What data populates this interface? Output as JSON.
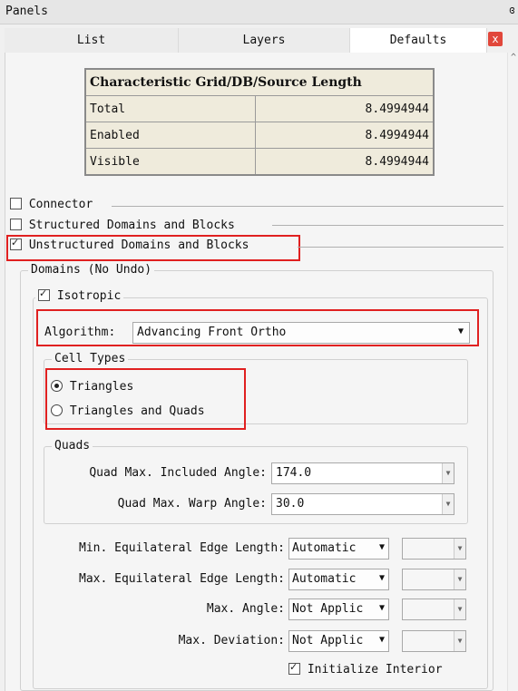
{
  "header": {
    "title": "Panels",
    "float_icon": "ɞ"
  },
  "tabs": [
    {
      "label": "List"
    },
    {
      "label": "Layers"
    },
    {
      "label": "Defaults"
    }
  ],
  "close_icon": "x",
  "table": {
    "header": "Characteristic Grid/DB/Source Length",
    "rows": [
      {
        "label": "Total",
        "value": "8.4994944"
      },
      {
        "label": "Enabled",
        "value": "8.4994944"
      },
      {
        "label": "Visible",
        "value": "8.4994944"
      }
    ]
  },
  "sections": {
    "connector": "Connector",
    "structured": "Structured Domains and Blocks",
    "unstructured": "Unstructured Domains and Blocks"
  },
  "domains": {
    "title": "Domains (No Undo)",
    "isotropic": "Isotropic",
    "algorithm_label": "Algorithm:",
    "algorithm_value": "Advancing Front Ortho",
    "cell_types": {
      "title": "Cell Types",
      "opt1": "Triangles",
      "opt2": "Triangles and Quads"
    },
    "quads": {
      "title": "Quads",
      "max_included_label": "Quad Max. Included Angle:",
      "max_included_value": "174.0",
      "max_warp_label": "Quad Max. Warp Angle:",
      "max_warp_value": "30.0"
    },
    "min_eq_label": "Min. Equilateral Edge Length:",
    "min_eq_value": "Automatic",
    "max_eq_label": "Max. Equilateral Edge Length:",
    "max_eq_value": "Automatic",
    "max_angle_label": "Max. Angle:",
    "max_angle_value": "Not Applic",
    "max_dev_label": "Max. Deviation:",
    "max_dev_value": "Not Applic",
    "init_interior": "Initialize Interior"
  },
  "colors": {
    "highlight": "#e02020",
    "table_bg": "#efebdc"
  }
}
